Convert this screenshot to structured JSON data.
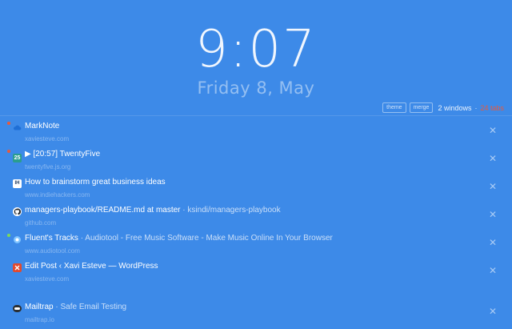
{
  "clock": {
    "time": "9:07",
    "date": "Friday 8, May"
  },
  "toolbar": {
    "theme_label": "theme",
    "merge_label": "merge",
    "windows_text": "2 windows",
    "separator": " · ",
    "tabs_text": "24 tabs",
    "tabs_color": "#e85a3c"
  },
  "tabs": [
    {
      "title": "MarkNote",
      "extra": "",
      "url": "xaviesteve.com",
      "icon": "cloud-icon",
      "badge_color": "#e85a3c"
    },
    {
      "title": "▶ [20:57] TwentyFive",
      "extra": "",
      "url": "twentyfive.js.org",
      "icon": "25-icon",
      "badge_color": "#e85a3c"
    },
    {
      "title": "How to brainstorm great business ideas",
      "extra": "",
      "url": "www.indiehackers.com",
      "icon": "ih-icon",
      "badge_color": ""
    },
    {
      "title": "managers-playbook/README.md at master",
      "extra": " · ksindi/managers-playbook",
      "url": "github.com",
      "icon": "github-icon",
      "badge_color": ""
    },
    {
      "title": "Fluent's Tracks",
      "extra": " · Audiotool - Free Music Software - Make Music Online In Your Browser",
      "url": "www.audiotool.com",
      "icon": "audiotool-icon",
      "badge_color": "#7ed957"
    },
    {
      "title": "Edit Post ‹ Xavi Esteve — WordPress",
      "extra": "",
      "url": "xaviesteve.com",
      "icon": "wordpress-icon",
      "badge_color": ""
    },
    {
      "title": "Mailtrap",
      "extra": " · Safe Email Testing",
      "url": "mailtrap.io",
      "icon": "mailtrap-icon",
      "badge_color": ""
    }
  ],
  "close_glyph": "✕"
}
